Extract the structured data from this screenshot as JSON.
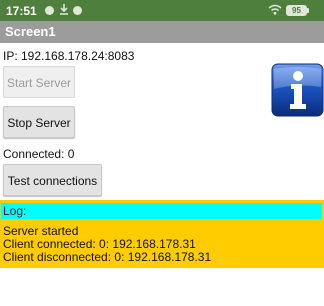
{
  "status_bar": {
    "time": "17:51",
    "battery": "95",
    "icons": [
      "notification-dot-icon",
      "download-icon",
      "notification-dot-icon",
      "wifi-icon",
      "battery-icon"
    ]
  },
  "app": {
    "title": "Screen1"
  },
  "server": {
    "ip_text": "IP:  192.168.178.24:8083",
    "start_label": "Start Server",
    "stop_label": "Stop Server",
    "connected_text": "Connected: 0",
    "test_label": "Test connections",
    "start_enabled": false
  },
  "log": {
    "label": "Log:",
    "lines": [
      "Server started",
      "Client connected: 0: 192.168.178.31",
      "Client disconnected: 0: 192.168.178.31"
    ]
  },
  "colors": {
    "status_bar": "#4f7f3d",
    "title_bar": "#9c9c9c",
    "log_background": "#ffcc00",
    "log_label_background": "#00ffff",
    "info_icon_blue": "#1b54c2"
  }
}
